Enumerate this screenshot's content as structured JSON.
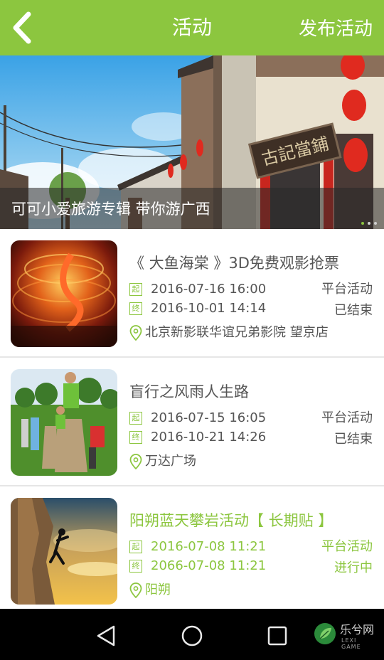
{
  "header": {
    "title": "活动",
    "publish_label": "发布活动"
  },
  "banner": {
    "caption": "可可小爱旅游专辑 带你游广西",
    "sign_text": "古記當鋪"
  },
  "activities": [
    {
      "title": "《 大鱼海棠 》3D免费观影抢票",
      "start_tag": "起",
      "start_time": "2016-07-16 16:00",
      "end_tag": "终",
      "end_time": "2016-10-01 14:14",
      "location": "北京新影联华谊兄弟影院 望京店",
      "type": "平台活动",
      "status": "已结束"
    },
    {
      "title": "盲行之风雨人生路",
      "start_tag": "起",
      "start_time": "2016-07-15 16:05",
      "end_tag": "终",
      "end_time": "2016-10-21 14:26",
      "location": "万达广场",
      "type": "平台活动",
      "status": "已结束"
    },
    {
      "title": "阳朔蓝天攀岩活动【 长期贴 】",
      "start_tag": "起",
      "start_time": "2016-07-08 11:21",
      "end_tag": "终",
      "end_time": "2066-07-08 11:21",
      "location": "阳朔",
      "type": "平台活动",
      "status": "进行中"
    }
  ],
  "watermark": {
    "name": "乐兮网",
    "sub": "LEXI GAME"
  },
  "colors": {
    "accent": "#8cc63f",
    "text": "#555555"
  }
}
